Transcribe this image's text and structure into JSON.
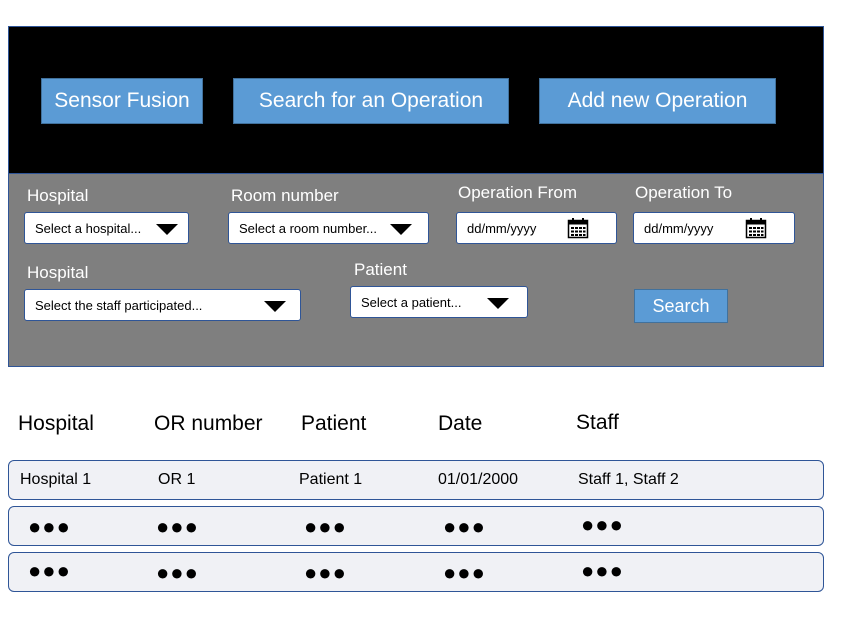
{
  "nav": {
    "sensor_fusion": "Sensor Fusion",
    "search_operation": "Search for an Operation",
    "add_operation": "Add new Operation"
  },
  "filters": {
    "hospital_label": "Hospital",
    "hospital_placeholder": "Select a hospital...",
    "room_label": "Room number",
    "room_placeholder": "Select a room number...",
    "op_from_label": "Operation From",
    "op_from_value": "dd/mm/yyyy",
    "op_to_label": "Operation To",
    "op_to_value": "dd/mm/yyyy",
    "staff_label": "Hospital",
    "staff_placeholder": "Select the staff participated...",
    "patient_label": "Patient",
    "patient_placeholder": "Select a patient...",
    "search_button": "Search"
  },
  "table": {
    "headers": [
      "Hospital",
      "OR number",
      "Patient",
      "Date",
      "Staff"
    ],
    "rows": [
      [
        "Hospital 1",
        "OR 1",
        "Patient 1",
        "01/01/2000",
        "Staff 1, Staff 2"
      ],
      [
        "●●●",
        "●●●",
        "●●●",
        "●●●",
        "●●●"
      ],
      [
        "●●●",
        "●●●",
        "●●●",
        "●●●",
        "●●●"
      ]
    ]
  },
  "colors": {
    "accent": "#5b9bd5",
    "nav_background": "#000000",
    "panel_background": "#7f7f7f",
    "row_background": "#f0f1f5",
    "border": "#2f5597"
  },
  "icons": {
    "dropdown": "chevron-down-icon",
    "date": "calendar-icon"
  }
}
